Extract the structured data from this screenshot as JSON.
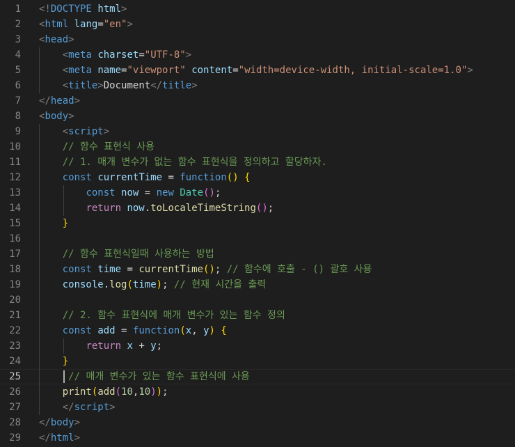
{
  "editor": {
    "current_line": 25,
    "lines": [
      [
        {
          "t": "<!",
          "c": "br"
        },
        {
          "t": "DOCTYPE",
          "c": "tag"
        },
        {
          "t": " ",
          "c": "txt"
        },
        {
          "t": "html",
          "c": "attr"
        },
        {
          "t": ">",
          "c": "br"
        }
      ],
      [
        {
          "t": "<",
          "c": "br"
        },
        {
          "t": "html",
          "c": "tag"
        },
        {
          "t": " ",
          "c": "txt"
        },
        {
          "t": "lang",
          "c": "attr"
        },
        {
          "t": "=",
          "c": "txt"
        },
        {
          "t": "\"en\"",
          "c": "str"
        },
        {
          "t": ">",
          "c": "br"
        }
      ],
      [
        {
          "t": "<",
          "c": "br"
        },
        {
          "t": "head",
          "c": "tag"
        },
        {
          "t": ">",
          "c": "br"
        }
      ],
      [
        {
          "t": "    ",
          "c": "txt"
        },
        {
          "t": "<",
          "c": "br"
        },
        {
          "t": "meta",
          "c": "tag"
        },
        {
          "t": " ",
          "c": "txt"
        },
        {
          "t": "charset",
          "c": "attr"
        },
        {
          "t": "=",
          "c": "txt"
        },
        {
          "t": "\"UTF-8\"",
          "c": "str"
        },
        {
          "t": ">",
          "c": "br"
        }
      ],
      [
        {
          "t": "    ",
          "c": "txt"
        },
        {
          "t": "<",
          "c": "br"
        },
        {
          "t": "meta",
          "c": "tag"
        },
        {
          "t": " ",
          "c": "txt"
        },
        {
          "t": "name",
          "c": "attr"
        },
        {
          "t": "=",
          "c": "txt"
        },
        {
          "t": "\"viewport\"",
          "c": "str"
        },
        {
          "t": " ",
          "c": "txt"
        },
        {
          "t": "content",
          "c": "attr"
        },
        {
          "t": "=",
          "c": "txt"
        },
        {
          "t": "\"width=device-width, initial-scale=1.0\"",
          "c": "str"
        },
        {
          "t": ">",
          "c": "br"
        }
      ],
      [
        {
          "t": "    ",
          "c": "txt"
        },
        {
          "t": "<",
          "c": "br"
        },
        {
          "t": "title",
          "c": "tag"
        },
        {
          "t": ">",
          "c": "br"
        },
        {
          "t": "Document",
          "c": "txt"
        },
        {
          "t": "</",
          "c": "br"
        },
        {
          "t": "title",
          "c": "tag"
        },
        {
          "t": ">",
          "c": "br"
        }
      ],
      [
        {
          "t": "</",
          "c": "br"
        },
        {
          "t": "head",
          "c": "tag"
        },
        {
          "t": ">",
          "c": "br"
        }
      ],
      [
        {
          "t": "<",
          "c": "br"
        },
        {
          "t": "body",
          "c": "tag"
        },
        {
          "t": ">",
          "c": "br"
        }
      ],
      [
        {
          "t": "    ",
          "c": "txt"
        },
        {
          "t": "<",
          "c": "br"
        },
        {
          "t": "script",
          "c": "tag"
        },
        {
          "t": ">",
          "c": "br"
        }
      ],
      [
        {
          "t": "    ",
          "c": "txt"
        },
        {
          "t": "// 함수 표현식 사용",
          "c": "cm"
        }
      ],
      [
        {
          "t": "    ",
          "c": "txt"
        },
        {
          "t": "// 1. 매개 변수가 없는 함수 표현식을 정의하고 할당하자.",
          "c": "cm"
        }
      ],
      [
        {
          "t": "    ",
          "c": "txt"
        },
        {
          "t": "const",
          "c": "kw"
        },
        {
          "t": " ",
          "c": "txt"
        },
        {
          "t": "currentTime",
          "c": "var"
        },
        {
          "t": " = ",
          "c": "txt"
        },
        {
          "t": "function",
          "c": "kw"
        },
        {
          "t": "()",
          "c": "p1"
        },
        {
          "t": " ",
          "c": "txt"
        },
        {
          "t": "{",
          "c": "p1"
        }
      ],
      [
        {
          "t": "        ",
          "c": "txt"
        },
        {
          "t": "const",
          "c": "kw"
        },
        {
          "t": " ",
          "c": "txt"
        },
        {
          "t": "now",
          "c": "var"
        },
        {
          "t": " = ",
          "c": "txt"
        },
        {
          "t": "new",
          "c": "kw"
        },
        {
          "t": " ",
          "c": "txt"
        },
        {
          "t": "Date",
          "c": "cls"
        },
        {
          "t": "()",
          "c": "p2"
        },
        {
          "t": ";",
          "c": "txt"
        }
      ],
      [
        {
          "t": "        ",
          "c": "txt"
        },
        {
          "t": "return",
          "c": "kw2"
        },
        {
          "t": " ",
          "c": "txt"
        },
        {
          "t": "now",
          "c": "var"
        },
        {
          "t": ".",
          "c": "txt"
        },
        {
          "t": "toLocaleTimeString",
          "c": "fn"
        },
        {
          "t": "()",
          "c": "p2"
        },
        {
          "t": ";",
          "c": "txt"
        }
      ],
      [
        {
          "t": "    ",
          "c": "txt"
        },
        {
          "t": "}",
          "c": "p1"
        }
      ],
      [],
      [
        {
          "t": "    ",
          "c": "txt"
        },
        {
          "t": "// 함수 표현식일때 사용하는 방법",
          "c": "cm"
        }
      ],
      [
        {
          "t": "    ",
          "c": "txt"
        },
        {
          "t": "const",
          "c": "kw"
        },
        {
          "t": " ",
          "c": "txt"
        },
        {
          "t": "time",
          "c": "var"
        },
        {
          "t": " = ",
          "c": "txt"
        },
        {
          "t": "currentTime",
          "c": "fn"
        },
        {
          "t": "()",
          "c": "p1"
        },
        {
          "t": "; ",
          "c": "txt"
        },
        {
          "t": "// 함수에 호출 - () 괄호 사용",
          "c": "cm"
        }
      ],
      [
        {
          "t": "    ",
          "c": "txt"
        },
        {
          "t": "console",
          "c": "var"
        },
        {
          "t": ".",
          "c": "txt"
        },
        {
          "t": "log",
          "c": "fn"
        },
        {
          "t": "(",
          "c": "p1"
        },
        {
          "t": "time",
          "c": "var"
        },
        {
          "t": ")",
          "c": "p1"
        },
        {
          "t": "; ",
          "c": "txt"
        },
        {
          "t": "// 현재 시간을 출력",
          "c": "cm"
        }
      ],
      [],
      [
        {
          "t": "    ",
          "c": "txt"
        },
        {
          "t": "// 2. 함수 표현식에 매개 변수가 있는 함수 정의",
          "c": "cm"
        }
      ],
      [
        {
          "t": "    ",
          "c": "txt"
        },
        {
          "t": "const",
          "c": "kw"
        },
        {
          "t": " ",
          "c": "txt"
        },
        {
          "t": "add",
          "c": "var"
        },
        {
          "t": " = ",
          "c": "txt"
        },
        {
          "t": "function",
          "c": "kw"
        },
        {
          "t": "(",
          "c": "p1"
        },
        {
          "t": "x",
          "c": "var"
        },
        {
          "t": ", ",
          "c": "txt"
        },
        {
          "t": "y",
          "c": "var"
        },
        {
          "t": ")",
          "c": "p1"
        },
        {
          "t": " ",
          "c": "txt"
        },
        {
          "t": "{",
          "c": "p1"
        }
      ],
      [
        {
          "t": "        ",
          "c": "txt"
        },
        {
          "t": "return",
          "c": "kw2"
        },
        {
          "t": " ",
          "c": "txt"
        },
        {
          "t": "x",
          "c": "var"
        },
        {
          "t": " + ",
          "c": "txt"
        },
        {
          "t": "y",
          "c": "var"
        },
        {
          "t": ";",
          "c": "txt"
        }
      ],
      [
        {
          "t": "    ",
          "c": "txt"
        },
        {
          "t": "}",
          "c": "p1"
        }
      ],
      [
        {
          "t": "     ",
          "c": "txt"
        },
        {
          "t": "// 매개 변수가 있는 함수 표현식에 사용",
          "c": "cm"
        }
      ],
      [
        {
          "t": "    ",
          "c": "txt"
        },
        {
          "t": "print",
          "c": "fn"
        },
        {
          "t": "(",
          "c": "p1"
        },
        {
          "t": "add",
          "c": "fn"
        },
        {
          "t": "(",
          "c": "p2"
        },
        {
          "t": "10",
          "c": "num"
        },
        {
          "t": ",",
          "c": "txt"
        },
        {
          "t": "10",
          "c": "num"
        },
        {
          "t": ")",
          "c": "p2"
        },
        {
          "t": ")",
          "c": "p1"
        },
        {
          "t": ";",
          "c": "txt"
        }
      ],
      [
        {
          "t": "    ",
          "c": "txt"
        },
        {
          "t": "</",
          "c": "br"
        },
        {
          "t": "script",
          "c": "tag"
        },
        {
          "t": ">",
          "c": "br"
        }
      ],
      [
        {
          "t": "</",
          "c": "br"
        },
        {
          "t": "body",
          "c": "tag"
        },
        {
          "t": ">",
          "c": "br"
        }
      ],
      [
        {
          "t": "</",
          "c": "br"
        },
        {
          "t": "html",
          "c": "tag"
        },
        {
          "t": ">",
          "c": "br"
        }
      ]
    ]
  }
}
